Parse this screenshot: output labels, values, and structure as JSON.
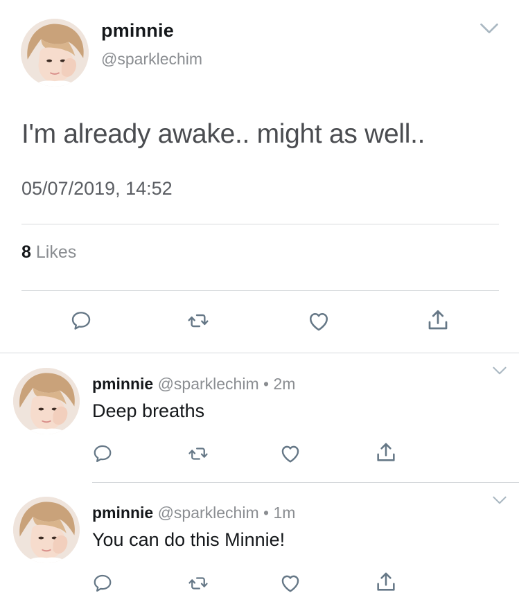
{
  "main_tweet": {
    "display_name": "pminnie",
    "handle": "@sparklechim",
    "text": "I'm already awake.. might as well..",
    "timestamp": "05/07/2019, 14:52",
    "likes_count": "8",
    "likes_label": "Likes"
  },
  "replies": [
    {
      "display_name": "pminnie",
      "handle": "@sparklechim",
      "separator": "•",
      "age": "2m",
      "text": "Deep breaths"
    },
    {
      "display_name": "pminnie",
      "handle": "@sparklechim",
      "separator": "•",
      "age": "1m",
      "text": "You can do this Minnie!"
    }
  ],
  "icons": {
    "reply": "reply-icon",
    "retweet": "retweet-icon",
    "like": "heart-icon",
    "share": "share-icon",
    "menu": "chevron-down-icon"
  },
  "colors": {
    "icon": "#657786",
    "text_primary": "#14171a",
    "text_secondary": "#8a8d91",
    "divider": "#d6d9dc"
  }
}
